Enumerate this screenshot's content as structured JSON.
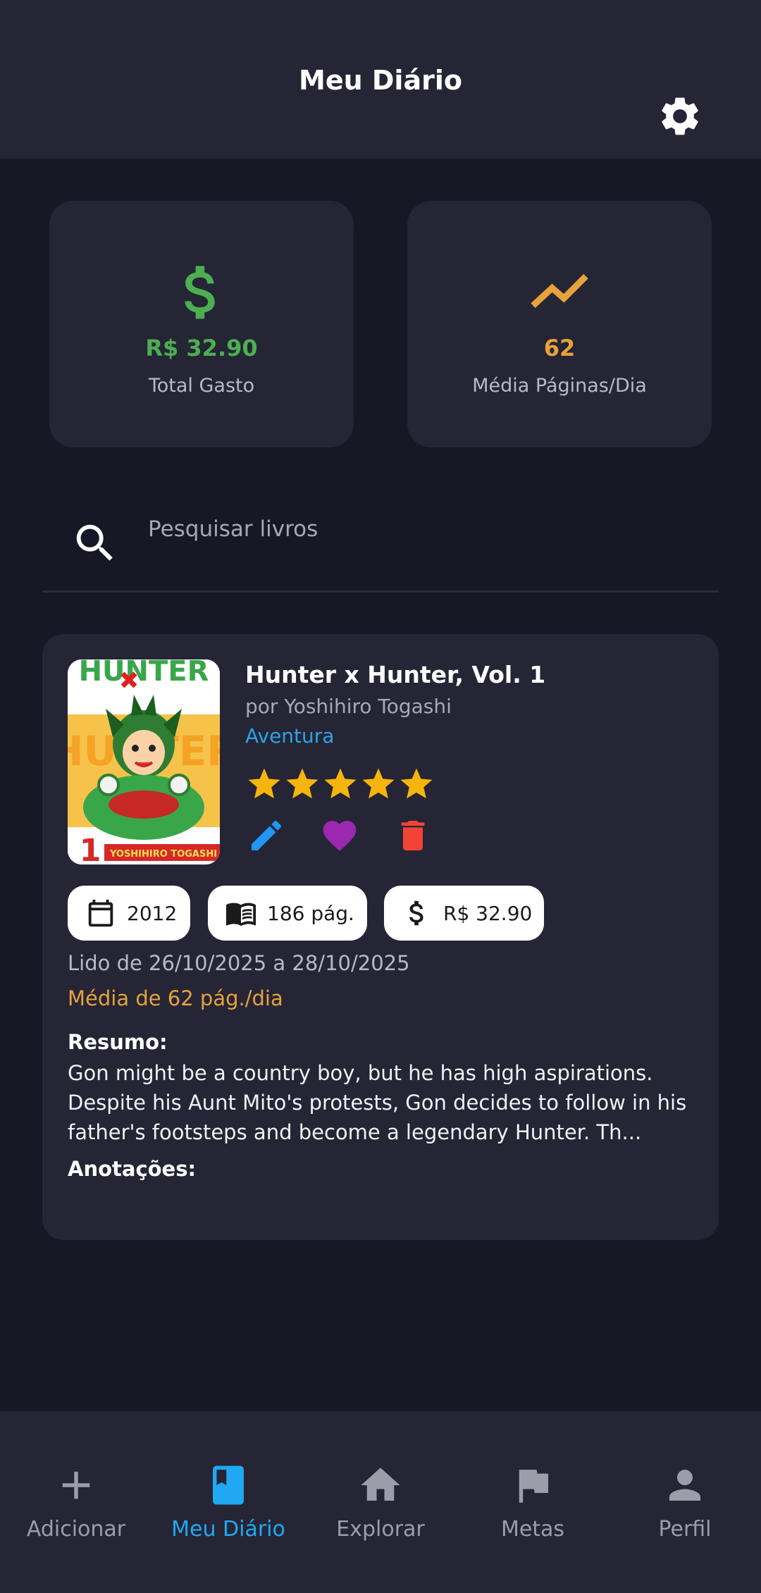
{
  "app_bar": {
    "title": "Meu Diário",
    "settings_icon": "gear-icon"
  },
  "stats": [
    {
      "icon": "dollar-icon",
      "value": "R$ 32.90",
      "label": "Total Gasto",
      "color": "#4caf50"
    },
    {
      "icon": "trending-up-icon",
      "value": "62",
      "label": "Média Páginas/Dia",
      "color": "#e8a23b"
    }
  ],
  "search": {
    "placeholder": "Pesquisar livros",
    "value": ""
  },
  "book": {
    "title": "Hunter x Hunter, Vol. 1",
    "author": "por Yoshihiro Togashi",
    "genre": "Aventura",
    "rating": 5,
    "rating_max": 5,
    "chips": {
      "year": "2012",
      "pages": "186 pág.",
      "price": "R$ 32.90"
    },
    "read_dates": "Lido de 26/10/2025 a 28/10/2025",
    "avg_pages": "Média de 62 pág./dia",
    "summary_label": "Resumo:",
    "summary": "Gon might be a country boy, but he has high aspirations. Despite his Aunt Mito's protests, Gon decides to follow in his father's footsteps and become a legendary Hunter. Th...",
    "notes_label": "Anotações:",
    "cover": {
      "title_text": "HUNTER",
      "author_text": "YOSHIHIRO TOGASHI",
      "volume": "1"
    }
  },
  "nav": [
    {
      "icon": "plus-icon",
      "label": "Adicionar",
      "active": false
    },
    {
      "icon": "book-icon",
      "label": "Meu Diário",
      "active": true
    },
    {
      "icon": "home-icon",
      "label": "Explorar",
      "active": false
    },
    {
      "icon": "flag-icon",
      "label": "Metas",
      "active": false
    },
    {
      "icon": "person-icon",
      "label": "Perfil",
      "active": false
    }
  ],
  "colors": {
    "background": "#171725",
    "surface": "#252536",
    "accent": "#20a8f2",
    "star": "#f5b50c",
    "edit": "#2196f3",
    "favorite": "#9c27b0",
    "delete": "#f44336",
    "genre": "#2ea3e6"
  }
}
